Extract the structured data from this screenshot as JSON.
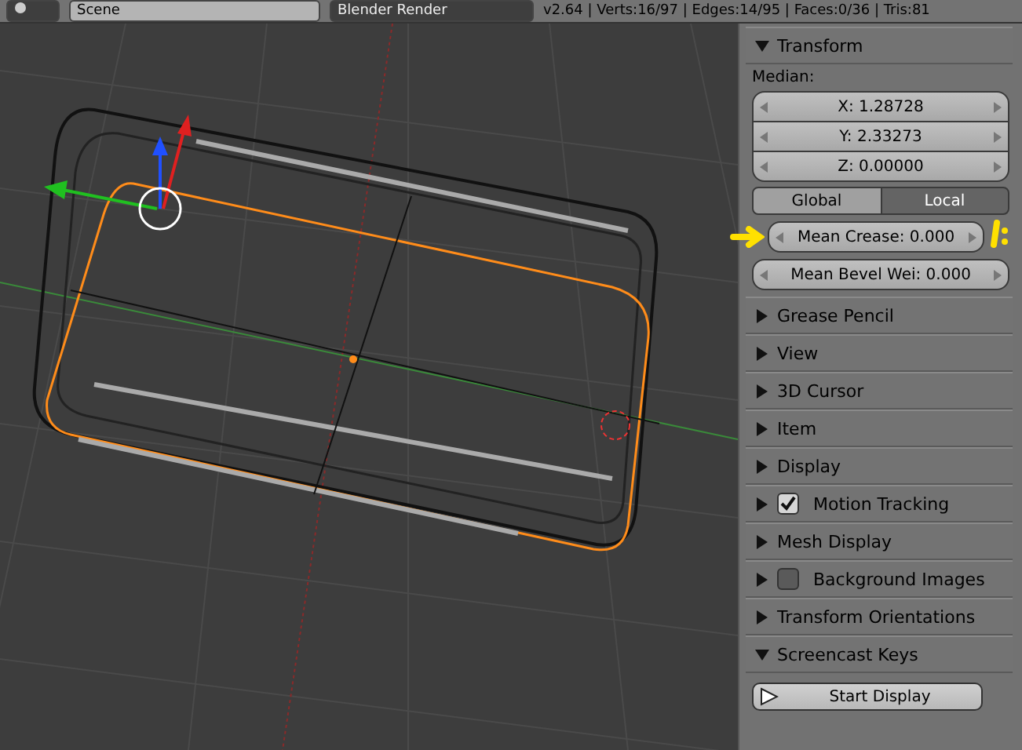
{
  "header": {
    "scene": "Scene",
    "render_engine": "Blender Render",
    "stats": "v2.64 | Verts:16/97 | Edges:14/95 | Faces:0/36 | Tris:81"
  },
  "transform": {
    "title": "Transform",
    "expanded": true,
    "median_label": "Median:",
    "fields": [
      {
        "label": "X: 1.28728"
      },
      {
        "label": "Y: 2.33273"
      },
      {
        "label": "Z: 0.00000"
      }
    ],
    "space": [
      {
        "label": "Global",
        "selected": false
      },
      {
        "label": "Local",
        "selected": true
      }
    ],
    "crease": "Mean Crease: 0.000",
    "bevel": "Mean Bevel Wei: 0.000"
  },
  "panels": [
    {
      "kind": "plain",
      "title": "Grease Pencil",
      "expanded": false
    },
    {
      "kind": "plain",
      "title": "View",
      "expanded": false
    },
    {
      "kind": "plain",
      "title": "3D Cursor",
      "expanded": false
    },
    {
      "kind": "plain",
      "title": "Item",
      "expanded": false
    },
    {
      "kind": "plain",
      "title": "Display",
      "expanded": false
    },
    {
      "kind": "checkbox",
      "title": "Motion Tracking",
      "expanded": false,
      "checked": true
    },
    {
      "kind": "plain",
      "title": "Mesh Display",
      "expanded": false
    },
    {
      "kind": "checkbox",
      "title": "Background Images",
      "expanded": false,
      "checked": false
    },
    {
      "kind": "plain",
      "title": "Transform Orientations",
      "expanded": false
    },
    {
      "kind": "plain",
      "title": "Screencast Keys",
      "expanded": true,
      "button": "Start Display"
    }
  ]
}
